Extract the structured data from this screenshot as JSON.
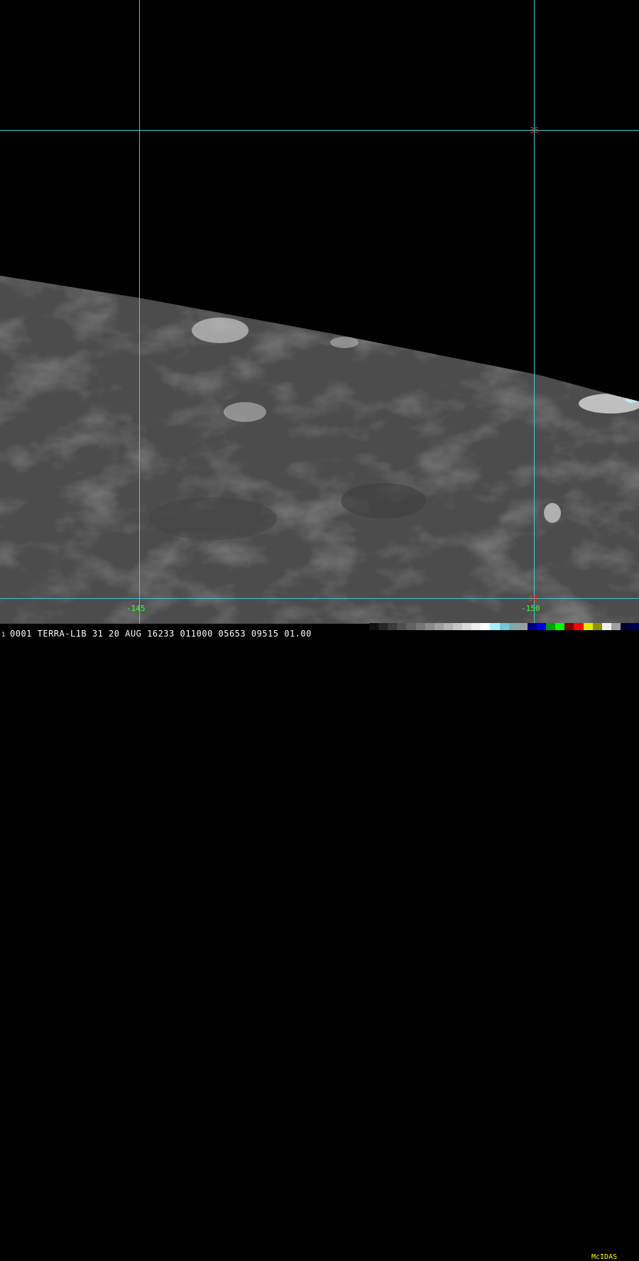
{
  "header": {
    "frame_number": "1",
    "status_text": "0001 TERRA-L1B 31 20 AUG 16233 011000 05653 09515 01.00",
    "brand": "McIDAS"
  },
  "grid": {
    "lat_labels": [
      "35",
      "30"
    ],
    "lon_labels": [
      "-145",
      "-150"
    ]
  },
  "colors": {
    "grid": "#3fc9d4",
    "lat_label": "#ff2a2a",
    "lon_label": "#33ff33",
    "brand": "#ffff00",
    "colorbar": [
      "#111111",
      "#262626",
      "#3a3a3a",
      "#4e4e4e",
      "#626262",
      "#767676",
      "#8a8a8a",
      "#9e9e9e",
      "#b2b2b2",
      "#c6c6c6",
      "#dadada",
      "#eeeeee",
      "#ffffff",
      "#a8f0f8",
      "#70c8d8",
      "#80a8b0",
      "#9aa0a0",
      "#000080",
      "#0000e8",
      "#00a000",
      "#00ff00",
      "#800000",
      "#ff0000",
      "#e8e800",
      "#909000",
      "#f0f0f0",
      "#a0a0a0",
      "#000030",
      "#000050"
    ]
  },
  "icons": [
    "satellite-imagery-icon"
  ]
}
